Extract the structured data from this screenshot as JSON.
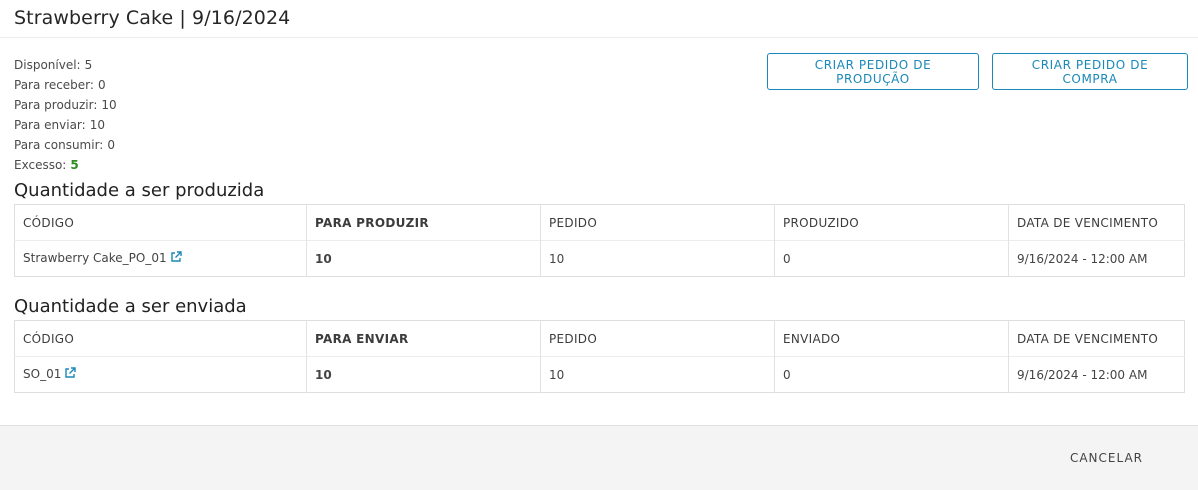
{
  "header": {
    "title": "Strawberry Cake | 9/16/2024"
  },
  "stats": [
    {
      "label": "Disponível:",
      "value": "5"
    },
    {
      "label": "Para receber:",
      "value": "0"
    },
    {
      "label": "Para produzir:",
      "value": "10"
    },
    {
      "label": "Para enviar:",
      "value": "10"
    },
    {
      "label": "Para consumir:",
      "value": "0"
    },
    {
      "label": "Excesso:",
      "value": "5"
    }
  ],
  "actions": {
    "produce_label": "CRIAR PEDIDO DE PRODUÇÃO",
    "buy_label": "CRIAR PEDIDO DE COMPRA"
  },
  "production": {
    "title": "Quantidade a ser produzida",
    "columns": [
      "CÓDIGO",
      "PARA PRODUZIR",
      "PEDIDO",
      "PRODUZIDO",
      "DATA DE VENCIMENTO"
    ],
    "rows": [
      {
        "code": "Strawberry Cake_PO_01",
        "qty": "10",
        "ordered": "10",
        "done": "0",
        "due": "9/16/2024 - 12:00 AM"
      }
    ]
  },
  "shipping": {
    "title": "Quantidade a ser enviada",
    "columns": [
      "CÓDIGO",
      "PARA ENVIAR",
      "PEDIDO",
      "ENVIADO",
      "DATA DE VENCIMENTO"
    ],
    "rows": [
      {
        "code": "SO_01",
        "qty": "10",
        "ordered": "10",
        "done": "0",
        "due": "9/16/2024 - 12:00 AM"
      }
    ]
  },
  "footer": {
    "cancel_label": "CANCELAR"
  },
  "colors": {
    "accent": "#1a88b8",
    "excess": "#2e8b1f",
    "footer_bg": "#f4f4f4"
  },
  "icons": {
    "external_link": "external-link-icon"
  }
}
